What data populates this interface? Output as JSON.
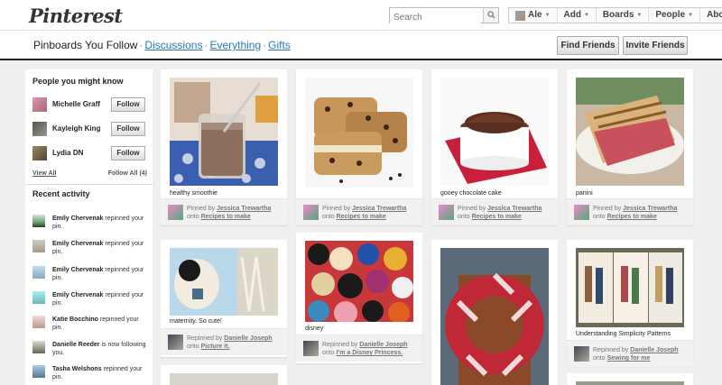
{
  "header": {
    "logo": "Pinterest",
    "search_placeholder": "Search",
    "nav": {
      "user": "Ale",
      "add": "Add",
      "boards": "Boards",
      "people": "People",
      "about": "About"
    }
  },
  "subheader": {
    "current": "Pinboards You Follow",
    "links": [
      "Discussions",
      "Everything",
      "Gifts"
    ],
    "find_friends": "Find Friends",
    "invite_friends": "Invite Friends"
  },
  "sidebar": {
    "people_heading": "People you might know",
    "people": [
      {
        "name": "Michelle Graff",
        "button": "Follow"
      },
      {
        "name": "Kayleigh King",
        "button": "Follow"
      },
      {
        "name": "Lydia DN",
        "button": "Follow"
      }
    ],
    "view_all": "View All",
    "follow_all": "Follow All (4)",
    "activity_heading": "Recent activity",
    "activity": [
      {
        "name": "Emily Chervenak",
        "text": "repinned your pin."
      },
      {
        "name": "Emily Chervenak",
        "text": "repinned your pin."
      },
      {
        "name": "Emily Chervenak",
        "text": "repinned your pin."
      },
      {
        "name": "Emily Chervenak",
        "text": "repinned your pin."
      },
      {
        "name": "Katie Bocchino",
        "text": "repinned your pin."
      },
      {
        "name": "Danielle Reeder",
        "text": "is now following you."
      },
      {
        "name": "Tasha Welshons",
        "text": "repinned your pin."
      }
    ]
  },
  "pins": [
    {
      "desc": "healthy smoothie",
      "verb": "Pinned by",
      "user": "Jessica Trewartha",
      "board": "Recipes to make"
    },
    {
      "desc": "",
      "verb": "Pinned by",
      "user": "Jessica Trewartha",
      "board": "Recipes to make"
    },
    {
      "desc": "gooey chocolate cake",
      "verb": "Pinned by",
      "user": "Jessica Trewartha",
      "board": "Recipes to make"
    },
    {
      "desc": "panini",
      "verb": "Pinned by",
      "user": "Jessica Trewartha",
      "board": "Recipes to make"
    },
    {
      "desc": "maternity. So cute!",
      "verb": "Repinned by",
      "user": "Danielle Joseph",
      "board": "Picture it."
    },
    {
      "desc": "disney",
      "verb": "Repinned by",
      "user": "Danielle Joseph",
      "board": "I'm a Disney Princess."
    },
    {
      "desc": "",
      "verb": "",
      "user": "",
      "board": ""
    },
    {
      "desc": "Understanding Simplicity Patterns",
      "verb": "Repinned by",
      "user": "Danielle Joseph",
      "board": "Sewing for me"
    }
  ],
  "onto": "onto",
  "colors": {
    "link": "#2a7ab0",
    "background": "#f0efee",
    "button_gradient_top": "#f8f8f8"
  }
}
